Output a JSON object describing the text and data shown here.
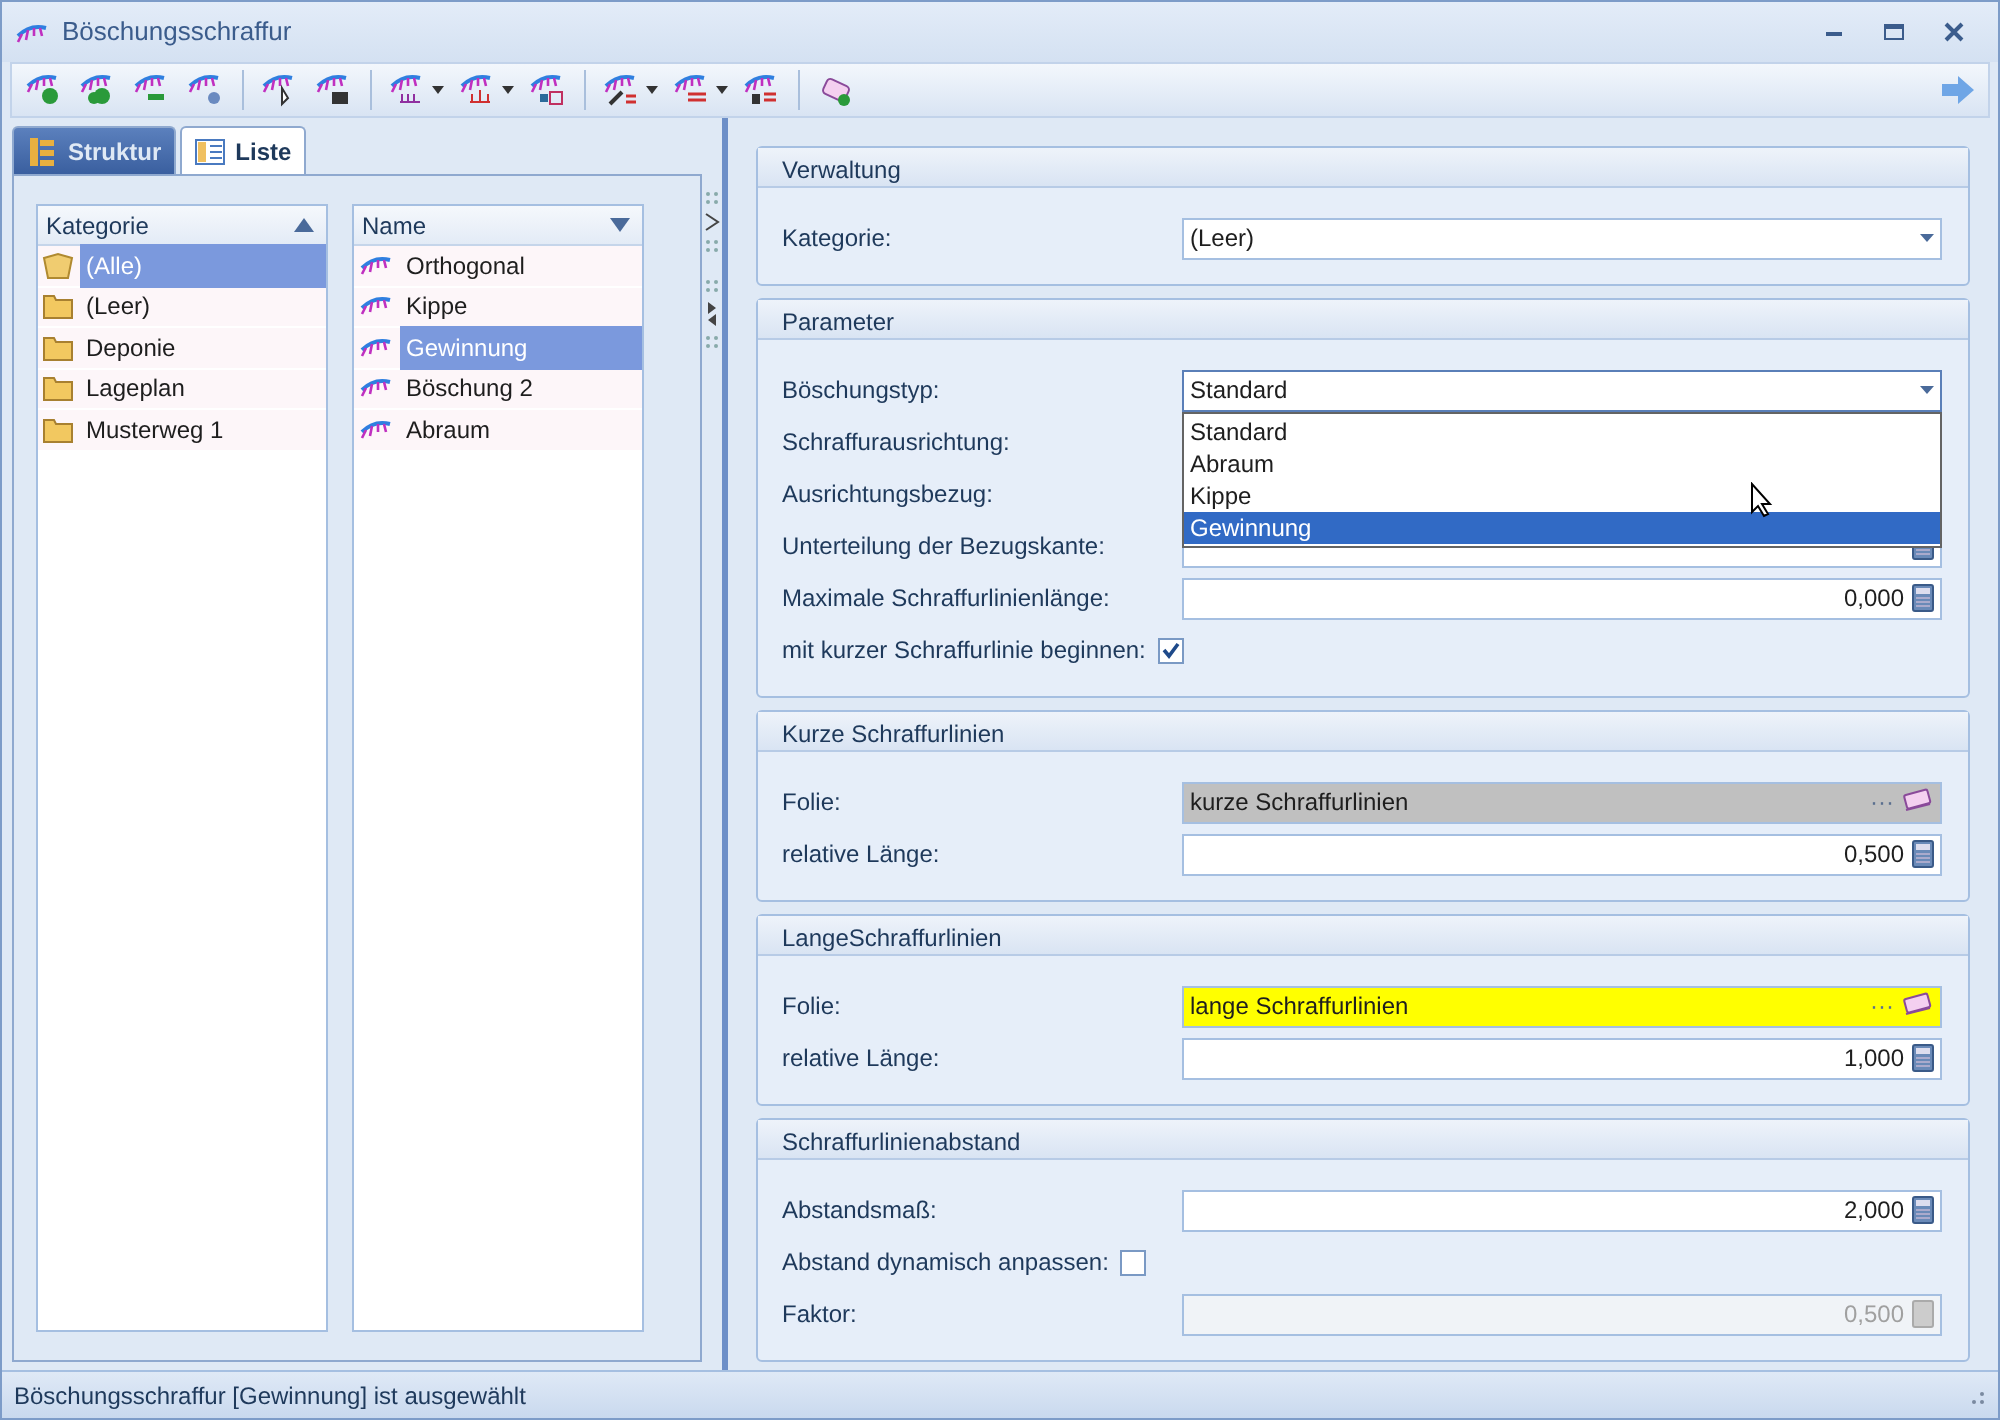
{
  "window": {
    "title": "Böschungsschraffur"
  },
  "toolbar": [
    {
      "kind": "button",
      "dropdown": false
    },
    {
      "kind": "button",
      "dropdown": false
    },
    {
      "kind": "button",
      "dropdown": false
    },
    {
      "kind": "button",
      "dropdown": false
    },
    {
      "kind": "separator"
    },
    {
      "kind": "button",
      "dropdown": false
    },
    {
      "kind": "button",
      "dropdown": false
    },
    {
      "kind": "separator"
    },
    {
      "kind": "button",
      "dropdown": true
    },
    {
      "kind": "button",
      "dropdown": true
    },
    {
      "kind": "button",
      "dropdown": false
    },
    {
      "kind": "separator"
    },
    {
      "kind": "button",
      "dropdown": true
    },
    {
      "kind": "button",
      "dropdown": true
    },
    {
      "kind": "button",
      "dropdown": false
    },
    {
      "kind": "separator"
    },
    {
      "kind": "button",
      "dropdown": false
    }
  ],
  "tabs": [
    {
      "label": "Struktur",
      "selected": false,
      "hovered": true
    },
    {
      "label": "Liste",
      "selected": true,
      "hovered": false
    }
  ],
  "category_list": {
    "column": "Kategorie",
    "ascending": true,
    "items": [
      {
        "label": "(Alle)",
        "kind": "all",
        "selected": true
      },
      {
        "label": "(Leer)",
        "kind": "folder",
        "selected": false
      },
      {
        "label": "Deponie",
        "kind": "folder",
        "selected": false
      },
      {
        "label": "Lageplan",
        "kind": "folder",
        "selected": false
      },
      {
        "label": "Musterweg 1",
        "kind": "folder",
        "selected": false
      }
    ]
  },
  "name_list": {
    "column": "Name",
    "ascending": false,
    "items": [
      {
        "label": "Orthogonal",
        "selected": false
      },
      {
        "label": "Kippe",
        "selected": false
      },
      {
        "label": "Gewinnung",
        "selected": true
      },
      {
        "label": "Böschung 2",
        "selected": false
      },
      {
        "label": "Abraum",
        "selected": false
      }
    ]
  },
  "sections": [
    {
      "title": "Verwaltung",
      "rows": [
        {
          "kind": "select",
          "label": "Kategorie:",
          "value": "(Leer)",
          "open": false
        }
      ]
    },
    {
      "title": "Parameter",
      "rows": [
        {
          "kind": "select",
          "label": "Böschungstyp:",
          "value": "Standard",
          "open": true,
          "options": [
            {
              "label": "Standard",
              "highlighted": false
            },
            {
              "label": "Abraum",
              "highlighted": false
            },
            {
              "label": "Kippe",
              "highlighted": false
            },
            {
              "label": "Gewinnung",
              "highlighted": true
            }
          ]
        },
        {
          "kind": "label",
          "label": "Schraffurausrichtung:"
        },
        {
          "kind": "label",
          "label": "Ausrichtungsbezug:"
        },
        {
          "kind": "number",
          "label": "Unterteilung der Bezugskante:",
          "disabled": false
        },
        {
          "kind": "number",
          "label": "Maximale Schraffurlinienlänge:",
          "value": "0,000",
          "disabled": false
        },
        {
          "kind": "checkbox",
          "label": "mit kurzer Schraffurlinie beginnen:",
          "checked": true
        }
      ]
    },
    {
      "title": "Kurze Schraffurlinien",
      "rows": [
        {
          "kind": "layer",
          "label": "Folie:",
          "value": "kurze Schraffurlinien",
          "browse": "···",
          "color": "#c0c0c0"
        },
        {
          "kind": "number",
          "label": "relative Länge:",
          "value": "0,500",
          "disabled": false
        }
      ]
    },
    {
      "title": "LangeSchraffurlinien",
      "rows": [
        {
          "kind": "layer",
          "label": "Folie:",
          "value": "lange Schraffurlinien",
          "browse": "···",
          "color": "#ffff00"
        },
        {
          "kind": "number",
          "label": "relative Länge:",
          "value": "1,000",
          "disabled": false
        }
      ]
    },
    {
      "title": "Schraffurlinienabstand",
      "rows": [
        {
          "kind": "number",
          "label": "Abstandsmaß:",
          "value": "2,000",
          "disabled": false
        },
        {
          "kind": "checkbox",
          "label": "Abstand dynamisch anpassen:",
          "checked": false
        },
        {
          "kind": "number",
          "label": "Faktor:",
          "value": "0,500",
          "disabled": true
        }
      ]
    }
  ],
  "status_bar": {
    "text": "Böschungsschraffur [Gewinnung] ist ausgewählt"
  }
}
